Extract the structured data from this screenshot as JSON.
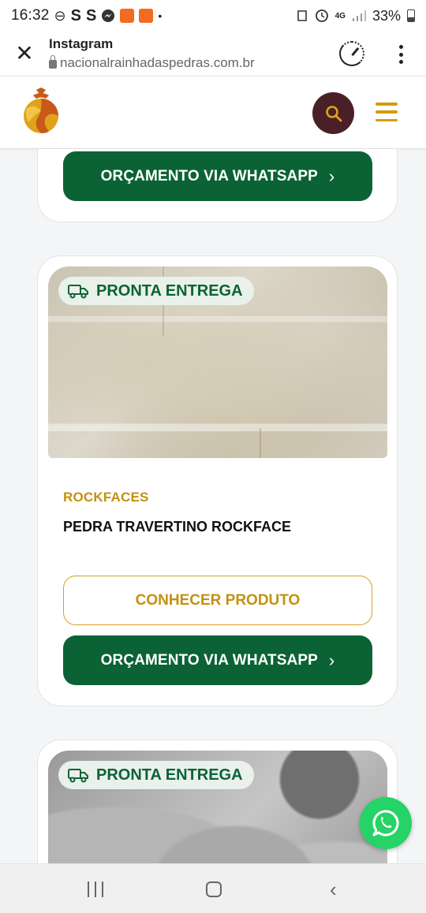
{
  "status_bar": {
    "time": "16:32",
    "letters": [
      "S",
      "S"
    ],
    "network": "4G",
    "battery": "33%"
  },
  "browser": {
    "title": "Instagram",
    "url": "nacionalrainhadaspedras.com.br"
  },
  "colors": {
    "brand_green": "#0b6335",
    "brand_gold": "#c4900f",
    "search_bg": "#4a2027",
    "whatsapp": "#25d366"
  },
  "icons": [
    "close-icon",
    "lock-icon",
    "speed-icon",
    "more-vert-icon",
    "search-icon",
    "menu-icon",
    "truck-icon",
    "whatsapp-icon",
    "chevron-right-icon"
  ],
  "cards": {
    "top": {
      "whatsapp_label": "ORÇAMENTO VIA WHATSAPP",
      "chevron": "›"
    },
    "main": {
      "badge": "PRONTA ENTREGA",
      "category": "ROCKFACES",
      "name": "PEDRA TRAVERTINO ROCKFACE",
      "details_label": "CONHECER PRODUTO",
      "whatsapp_label": "ORÇAMENTO VIA WHATSAPP",
      "chevron": "›"
    },
    "bottom": {
      "badge": "PRONTA ENTREGA"
    }
  }
}
